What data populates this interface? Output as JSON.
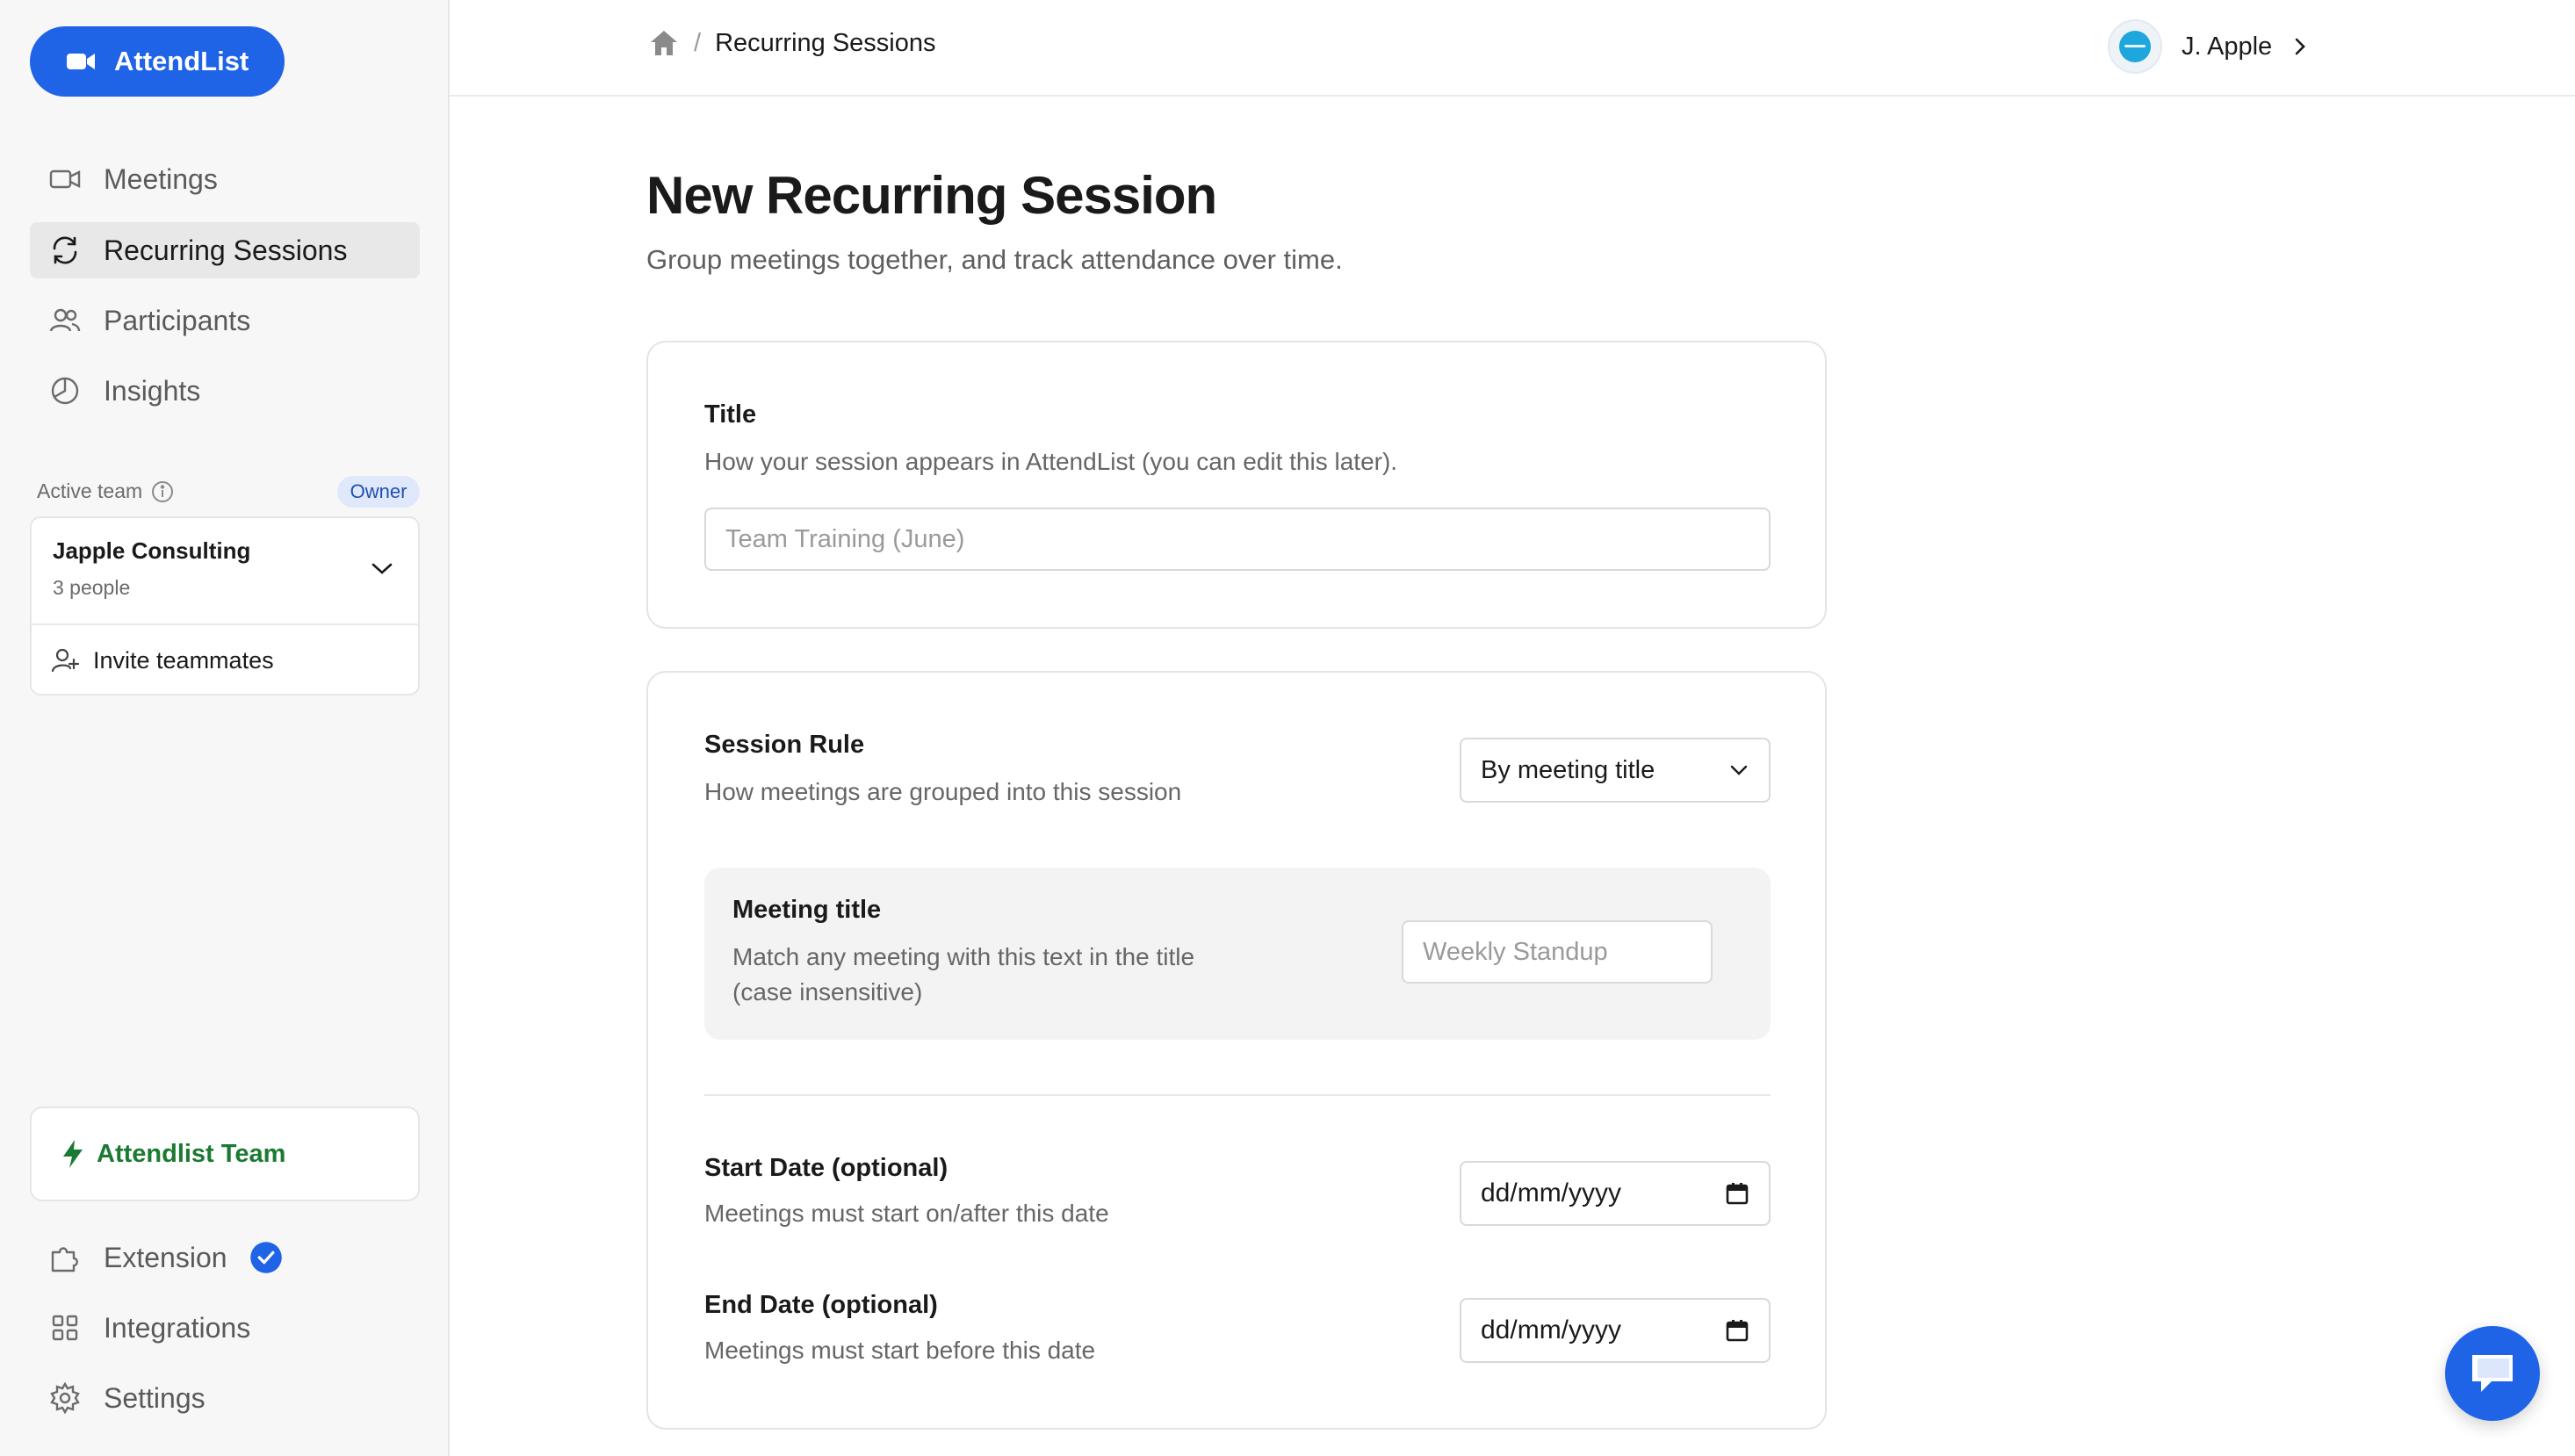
{
  "brand": {
    "name": "AttendList",
    "color": "#1f63e6",
    "icon": "video-camera-icon"
  },
  "nav": {
    "items": [
      {
        "label": "Meetings",
        "icon": "video-icon",
        "active": false
      },
      {
        "label": "Recurring Sessions",
        "icon": "refresh-icon",
        "active": true
      },
      {
        "label": "Participants",
        "icon": "users-icon",
        "active": false
      },
      {
        "label": "Insights",
        "icon": "pie-chart-icon",
        "active": false
      }
    ]
  },
  "team": {
    "active_label": "Active team",
    "role_badge": "Owner",
    "name": "Japple Consulting",
    "count": "3 people",
    "invite_label": "Invite teammates"
  },
  "upgrade": {
    "label": "Attendlist Team",
    "color": "#1b7a32"
  },
  "bottom_nav": [
    {
      "label": "Extension",
      "icon": "puzzle-icon",
      "verified": true
    },
    {
      "label": "Integrations",
      "icon": "grid-icon"
    },
    {
      "label": "Settings",
      "icon": "gear-icon"
    }
  ],
  "breadcrumb": {
    "home_icon": "home-icon",
    "separator": "/",
    "current": "Recurring Sessions"
  },
  "user": {
    "name": "J. Apple"
  },
  "page": {
    "title": "New Recurring Session",
    "subtitle": "Group meetings together, and track attendance over time."
  },
  "title_section": {
    "label": "Title",
    "description": "How your session appears in AttendList (you can edit this later).",
    "placeholder": "Team Training (June)"
  },
  "rule_section": {
    "label": "Session Rule",
    "description": "How meetings are grouped into this session",
    "selected": "By meeting title",
    "meeting_title": {
      "label": "Meeting title",
      "description_line1": "Match any meeting with this text in the title",
      "description_line2": "(case insensitive)",
      "placeholder": "Weekly Standup"
    },
    "start_date": {
      "label": "Start Date (optional)",
      "description": "Meetings must start on/after this date",
      "placeholder": "dd/mm/yyyy"
    },
    "end_date": {
      "label": "End Date (optional)",
      "description": "Meetings must start before this date",
      "placeholder": "dd/mm/yyyy"
    }
  },
  "chat": {
    "icon": "chat-bubble-icon"
  }
}
